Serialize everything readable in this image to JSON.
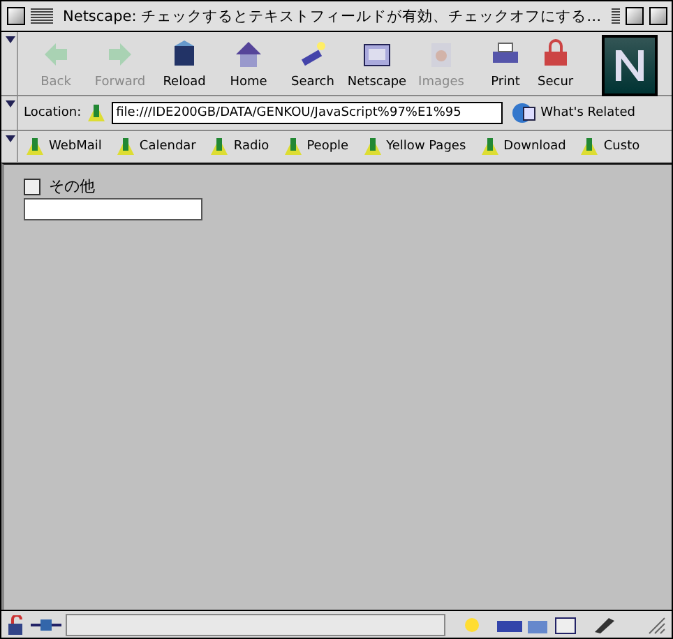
{
  "window": {
    "title": "Netscape: チェックするとテキストフィールドが有効、チェックオフにする…"
  },
  "toolbar": [
    {
      "label": "Back",
      "kind": "back",
      "disabled": true
    },
    {
      "label": "Forward",
      "kind": "forward",
      "disabled": true
    },
    {
      "label": "Reload",
      "kind": "reload",
      "disabled": false
    },
    {
      "label": "Home",
      "kind": "home",
      "disabled": false
    },
    {
      "label": "Search",
      "kind": "search",
      "disabled": false
    },
    {
      "label": "Netscape",
      "kind": "my",
      "disabled": false
    },
    {
      "label": "Images",
      "kind": "images",
      "disabled": true
    },
    {
      "label": "Print",
      "kind": "print",
      "disabled": false
    },
    {
      "label": "Secur",
      "kind": "security",
      "disabled": false
    }
  ],
  "location": {
    "label": "Location:",
    "value": "file:///IDE200GB/DATA/GENKOU/JavaScript%97%E1%95",
    "related": "What's Related"
  },
  "personal_bar": [
    "WebMail",
    "Calendar",
    "Radio",
    "People",
    "Yellow Pages",
    "Download",
    "Custo"
  ],
  "content": {
    "checkbox": {
      "label": "その他",
      "checked": false
    }
  }
}
